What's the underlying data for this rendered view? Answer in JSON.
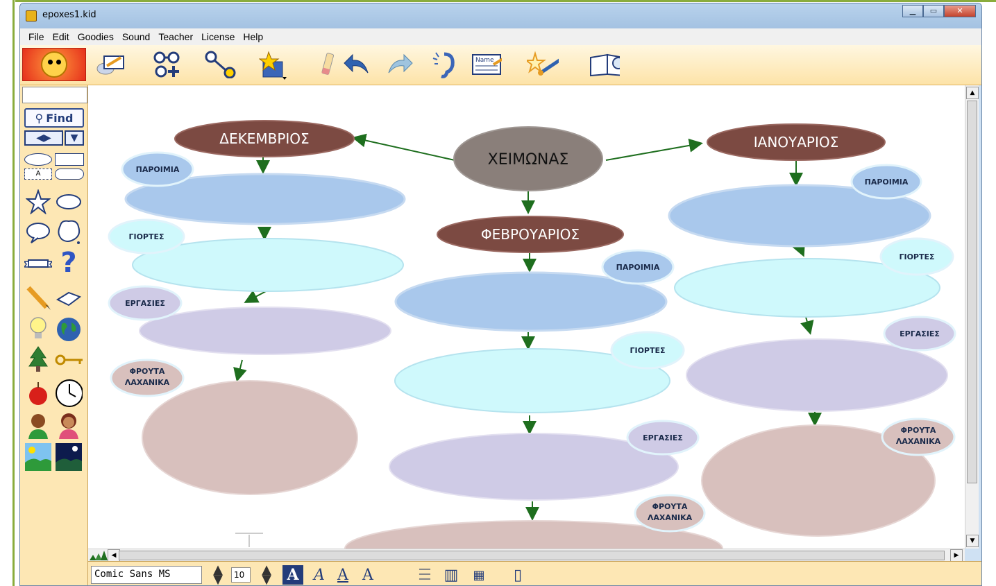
{
  "window": {
    "title": "epoxes1.kid"
  },
  "menu": [
    "File",
    "Edit",
    "Goodies",
    "Sound",
    "Teacher",
    "License",
    "Help"
  ],
  "sidebar": {
    "find_label": "Find"
  },
  "map": {
    "center": "ΧΕΙΜΩΝΑΣ",
    "months": [
      "ΔΕΚΕΜΒΡΙΟΣ",
      "ΦΕΒΡΟΥΑΡΙΟΣ",
      "ΙΑΝΟΥΑΡΙΟΣ"
    ],
    "label_proverbs": "ΠΑΡΟΙΜΙΑ",
    "label_holidays": "ΓΙΟΡΤΕΣ",
    "label_work": "ΕΡΓΑΣΙΕΣ",
    "label_fruit_line1": "ΦΡΟΥΤΑ",
    "label_fruit_line2": "ΛΑΧΑΝΙΚΑ"
  },
  "statusbar": {
    "font_name": "Comic Sans MS",
    "font_size": "10"
  },
  "colors": {
    "month_bubble": "#7c4a42",
    "center_bubble": "#8a7f7a",
    "proverb_oval": "#a9c8ec",
    "holiday_oval": "#cff9fc",
    "work_oval": "#cfcbe6",
    "fruit_oval": "#d8c0bd",
    "arrow": "#1e6e1e"
  }
}
